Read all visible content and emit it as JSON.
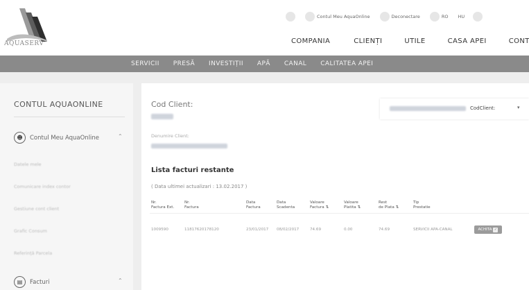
{
  "logo": {
    "text": "AQUASERV"
  },
  "topbar": {
    "account": "Contul Meu AquaOnline",
    "logout": "Deconectare",
    "lang_ro": "RO",
    "lang_hu": "HU"
  },
  "main_nav": [
    "COMPANIA",
    "CLIENȚI",
    "UTILE",
    "CASA APEI",
    "CONTACT"
  ],
  "sub_nav": [
    "SERVICII",
    "PRESĂ",
    "INVESTIȚII",
    "APĂ",
    "CANAL",
    "CALITATEA APEI"
  ],
  "sidebar": {
    "title": "CONTUL AQUAONLINE",
    "section1": {
      "label": "Contul Meu AquaOnline",
      "icon": "user-icon"
    },
    "links": [
      "Datele mele",
      "Comunicare index contor",
      "Gestiune cont client",
      "Grafic Consum",
      "Referință Parcela"
    ],
    "section2": {
      "label": "Facturi",
      "icon": "invoice-icon"
    }
  },
  "panel": {
    "cod_client_label": "Cod Client:",
    "select_value": "CodClient:",
    "denumire_label": "Denumire Client:",
    "list_title": "Lista facturi restante",
    "list_date": "( Data ultimei actualizari : 13.02.2017 )",
    "headers": [
      [
        "Nr.",
        "Factura Ext."
      ],
      [
        "Nr.",
        "Factura"
      ],
      [
        "Data",
        "Factura"
      ],
      [
        "Data",
        "Scadenta"
      ],
      [
        "Valoare",
        "Factura ⇅"
      ],
      [
        "Valoare",
        "Platita ⇅"
      ],
      [
        "Rest",
        "de Plata ⇅"
      ],
      [
        "Tip",
        "Prestatie"
      ]
    ],
    "row": [
      "1009590",
      "11817620178120",
      "23/01/2017",
      "08/02/2017",
      "74.69",
      "0.00",
      "74.69",
      "SERVICII APA-CANAL"
    ],
    "pay_button": "ACHITA"
  }
}
